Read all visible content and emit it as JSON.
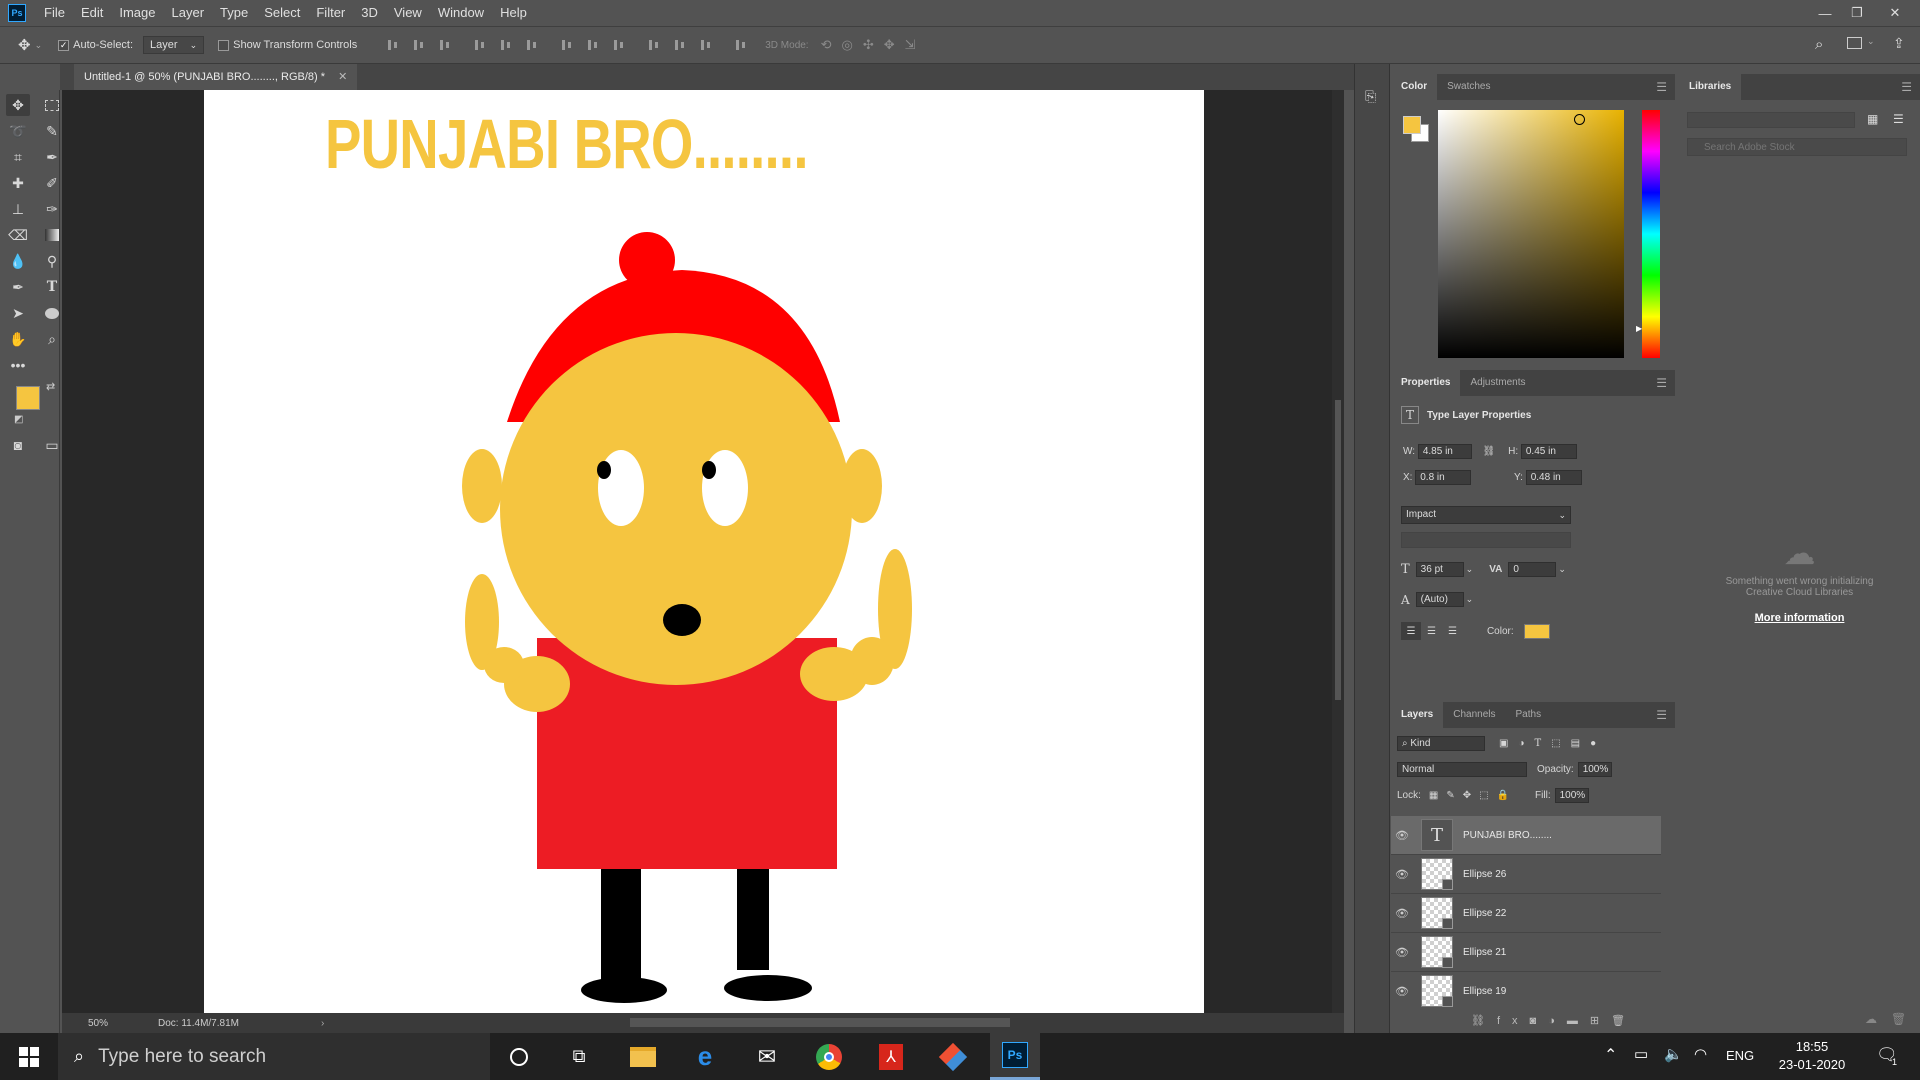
{
  "app": {
    "logo": "Ps"
  },
  "menu": [
    "File",
    "Edit",
    "Image",
    "Layer",
    "Type",
    "Select",
    "Filter",
    "3D",
    "View",
    "Window",
    "Help"
  ],
  "options": {
    "auto_select_label": "Auto-Select:",
    "auto_select_value": "Layer",
    "show_transform_label": "Show Transform Controls",
    "mode_3d_label": "3D Mode:"
  },
  "document": {
    "tab_title": "Untitled-1 @ 50% (PUNJABI BRO........, RGB/8) *",
    "canvas_text": "PUNJABI BRO........",
    "zoom": "50%",
    "doc_size": "Doc: 11.4M/7.81M"
  },
  "colors": {
    "foreground": "#f5c540",
    "background": "#ffffff",
    "accent": "#f5c540",
    "red": "#ed1c24",
    "turban": "#ff0000"
  },
  "color_panel": {
    "tabs": [
      "Color",
      "Swatches"
    ]
  },
  "libraries_panel": {
    "title": "Libraries",
    "search_placeholder": "Search Adobe Stock",
    "error_line1": "Something went wrong initializing",
    "error_line2": "Creative Cloud Libraries",
    "more_info": "More information"
  },
  "properties": {
    "tabs": [
      "Properties",
      "Adjustments"
    ],
    "title": "Type Layer Properties",
    "w_label": "W:",
    "w": "4.85 in",
    "h_label": "H:",
    "h": "0.45 in",
    "x_label": "X:",
    "x": "0.8 in",
    "y_label": "Y:",
    "y": "0.48 in",
    "font": "Impact",
    "size": "36 pt",
    "tracking": "0",
    "leading": "(Auto)",
    "color_label": "Color:"
  },
  "layers_panel": {
    "tabs": [
      "Layers",
      "Channels",
      "Paths"
    ],
    "filter": "Kind",
    "blend_mode": "Normal",
    "opacity_label": "Opacity:",
    "opacity": "100%",
    "lock_label": "Lock:",
    "fill_label": "Fill:",
    "fill": "100%",
    "layers": [
      {
        "name": "PUNJABI BRO........",
        "kind": "type",
        "selected": true
      },
      {
        "name": "Ellipse 26",
        "kind": "shape"
      },
      {
        "name": "Ellipse 22",
        "kind": "shape"
      },
      {
        "name": "Ellipse 21",
        "kind": "shape"
      },
      {
        "name": "Ellipse 19",
        "kind": "shape"
      }
    ]
  },
  "taskbar": {
    "search_placeholder": "Type here to search",
    "language": "ENG",
    "time": "18:55",
    "date": "23-01-2020",
    "notifications": "1",
    "apps": [
      "task-view-icon",
      "file-explorer-icon",
      "edge-icon",
      "mail-icon",
      "chrome-icon",
      "acrobat-icon",
      "git-icon",
      "photoshop-icon"
    ]
  }
}
